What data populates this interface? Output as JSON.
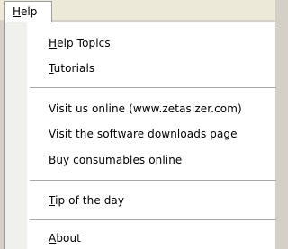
{
  "menubar": {
    "help_label": "Help",
    "help_accel": "H",
    "help_rest": "elp"
  },
  "menu": {
    "items": [
      {
        "accel": "H",
        "rest": "elp Topics",
        "label": "Help Topics"
      },
      {
        "accel": "T",
        "rest": "utorials",
        "label": "Tutorials"
      },
      {
        "label": "Visit us online (www.zetasizer.com)"
      },
      {
        "label": "Visit the software downloads page"
      },
      {
        "label": "Buy consumables online"
      },
      {
        "accel": "T",
        "rest": "ip of the day",
        "label": "Tip of the day"
      },
      {
        "accel": "A",
        "rest": "bout",
        "label": "About"
      }
    ]
  }
}
